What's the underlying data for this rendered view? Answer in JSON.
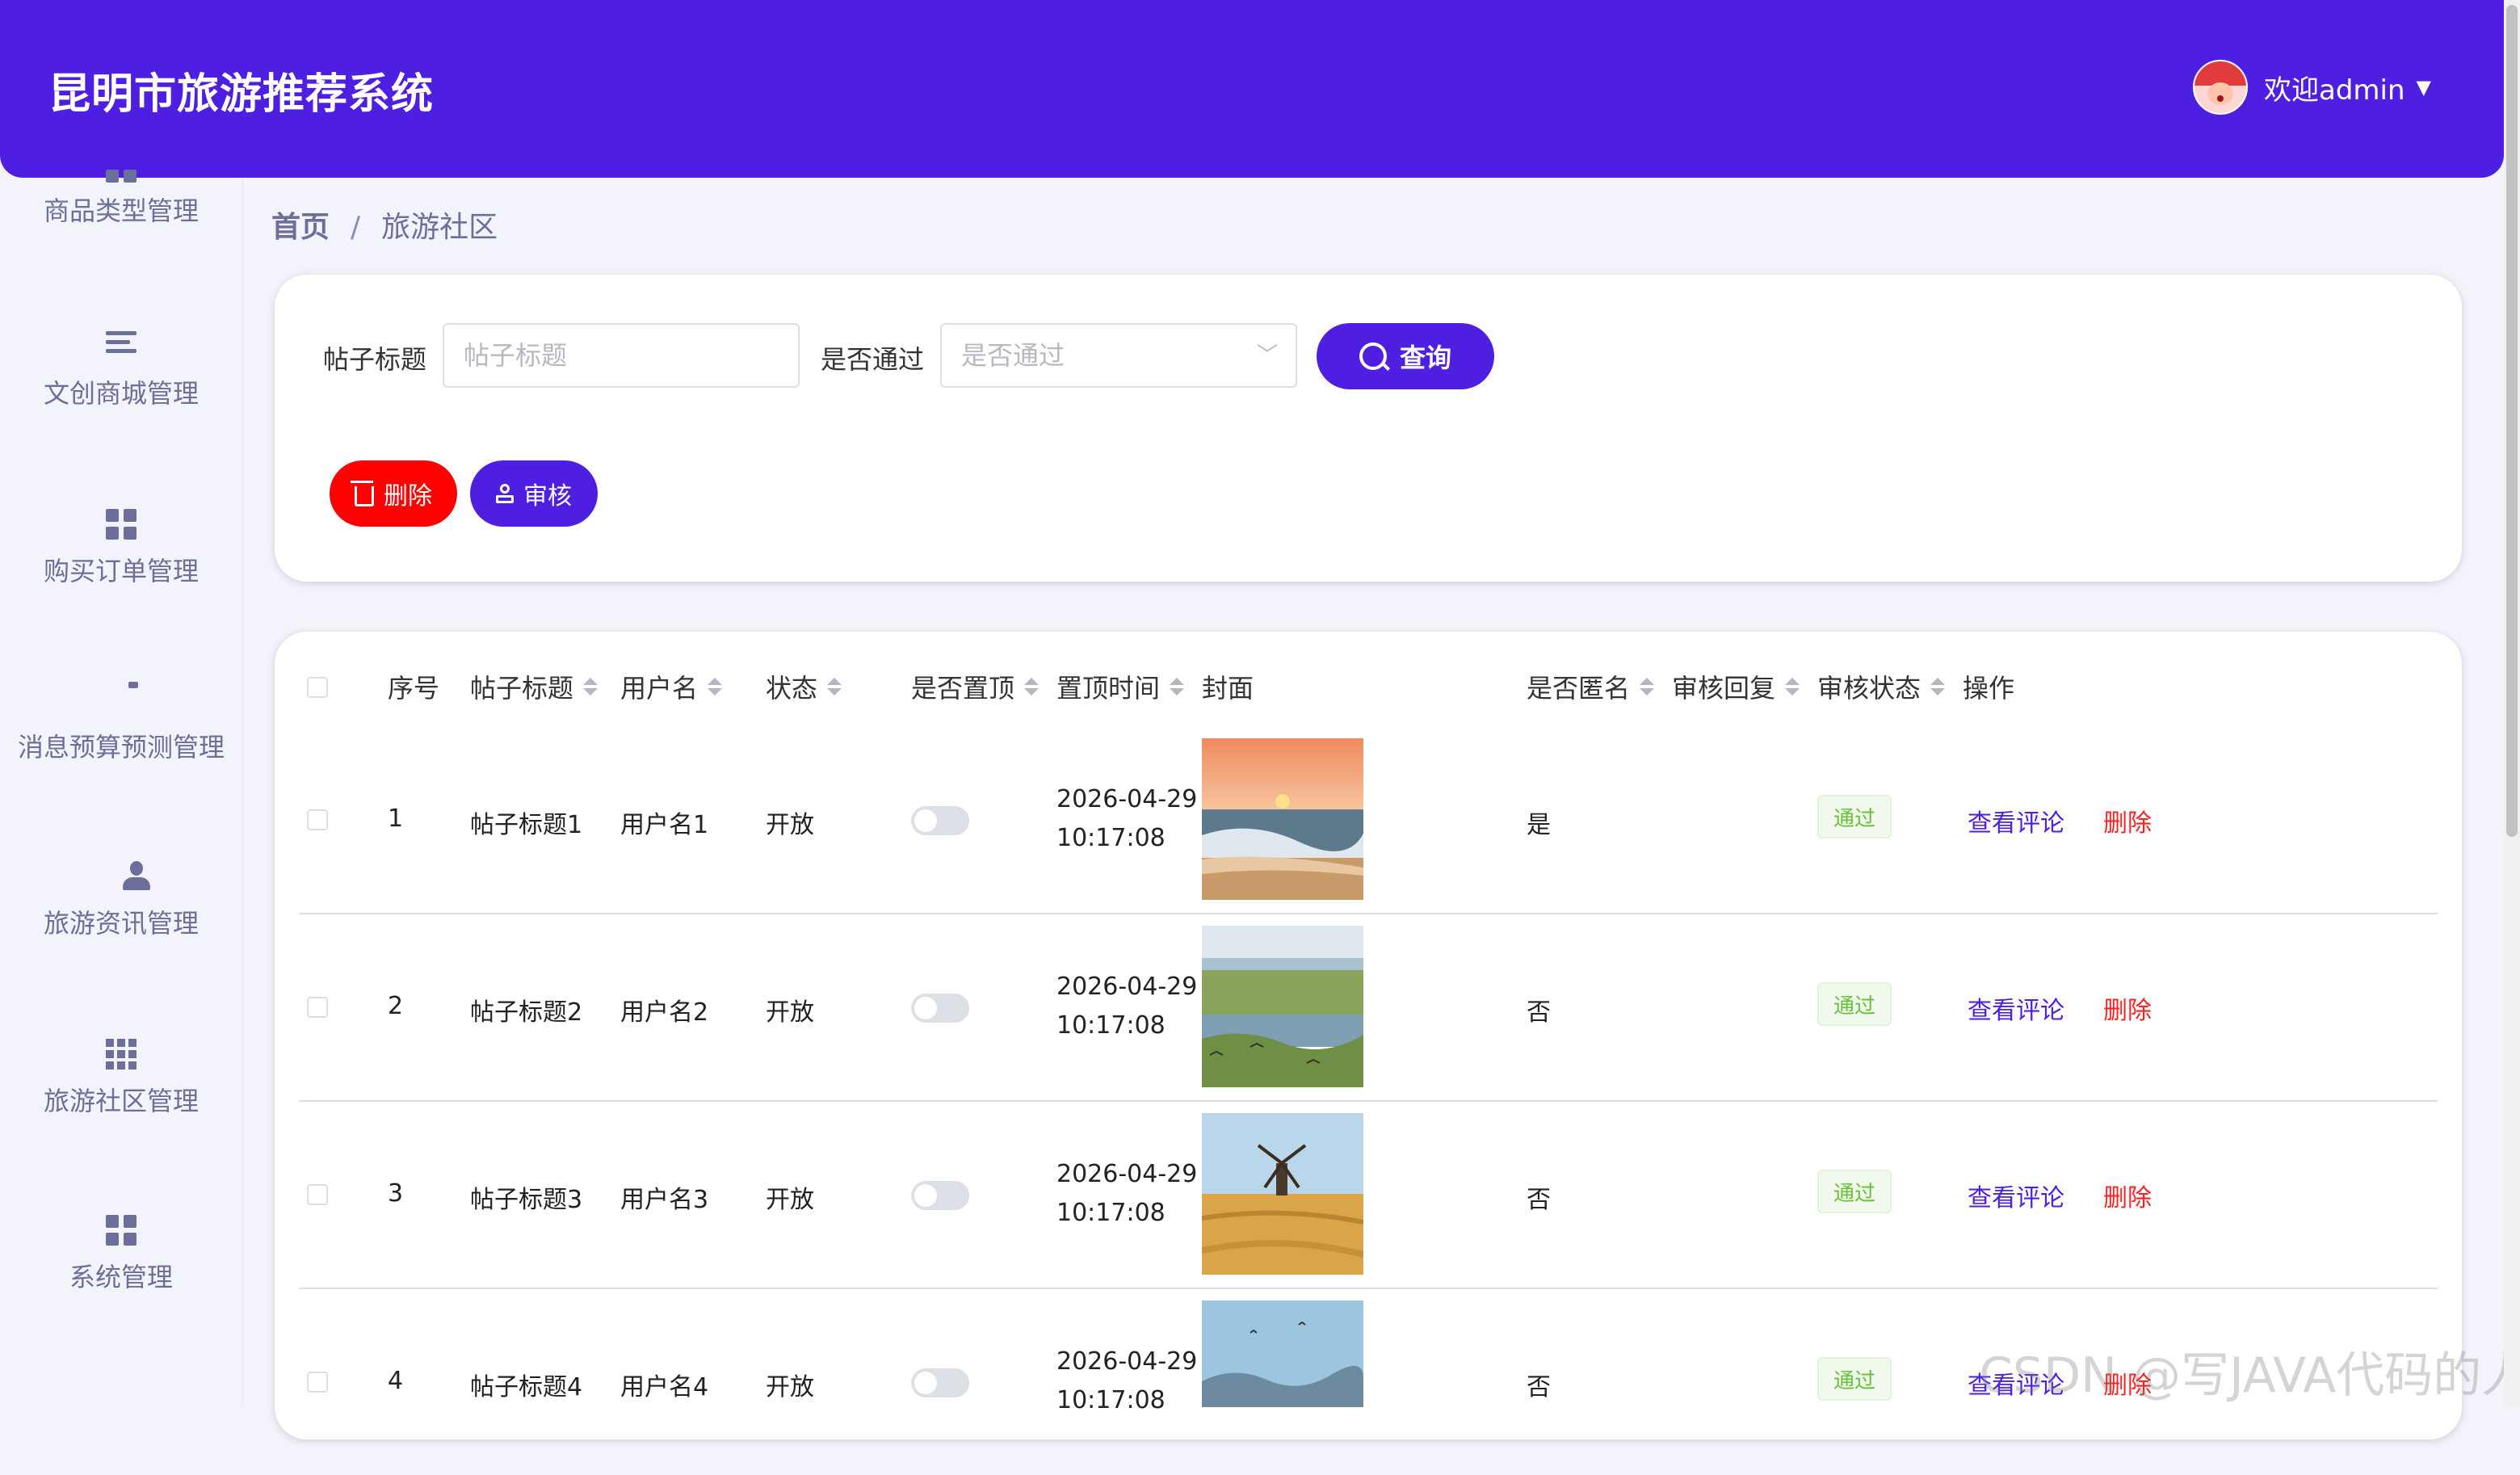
{
  "header": {
    "title": "昆明市旅游推荐系统",
    "welcome": "欢迎admin"
  },
  "sidebar": {
    "items": [
      {
        "label": "商品类型管理",
        "icon": "grid-icon"
      },
      {
        "label": "文创商城管理",
        "icon": "list-icon"
      },
      {
        "label": "购买订单管理",
        "icon": "grid-icon"
      },
      {
        "label": "消息预算预测管理",
        "icon": "clipboard-icon"
      },
      {
        "label": "旅游资讯管理",
        "icon": "user-icon"
      },
      {
        "label": "旅游社区管理",
        "icon": "apps-icon"
      },
      {
        "label": "系统管理",
        "icon": "grid-icon"
      }
    ]
  },
  "breadcrumb": {
    "home": "首页",
    "sep": "/",
    "current": "旅游社区"
  },
  "search": {
    "title_label": "帖子标题",
    "title_placeholder": "帖子标题",
    "pass_label": "是否通过",
    "pass_placeholder": "是否通过",
    "query_label": "查询",
    "delete_label": "删除",
    "audit_label": "审核"
  },
  "table": {
    "columns": [
      "序号",
      "帖子标题",
      "用户名",
      "状态",
      "是否置顶",
      "置顶时间",
      "封面",
      "是否匿名",
      "审核回复",
      "审核状态",
      "操作"
    ],
    "rows": [
      {
        "index": "1",
        "title": "帖子标题1",
        "username": "用户名1",
        "status": "开放",
        "date": "2026-04-29",
        "time": "10:17:08",
        "anonymous": "是",
        "audit": "通过",
        "view": "查看评论",
        "delete": "删除"
      },
      {
        "index": "2",
        "title": "帖子标题2",
        "username": "用户名2",
        "status": "开放",
        "date": "2026-04-29",
        "time": "10:17:08",
        "anonymous": "否",
        "audit": "通过",
        "view": "查看评论",
        "delete": "删除"
      },
      {
        "index": "3",
        "title": "帖子标题3",
        "username": "用户名3",
        "status": "开放",
        "date": "2026-04-29",
        "time": "10:17:08",
        "anonymous": "否",
        "audit": "通过",
        "view": "查看评论",
        "delete": "删除"
      },
      {
        "index": "4",
        "title": "帖子标题4",
        "username": "用户名4",
        "status": "开放",
        "date": "2026-04-29",
        "time": "10:17:08",
        "anonymous": "否",
        "audit": "通过",
        "view": "查看评论",
        "delete": "删除"
      }
    ]
  },
  "watermark": "CSDN @写JAVA代码的人",
  "colors": {
    "primary": "#4f1fe1",
    "danger": "#ff0000",
    "success": "#67c23a"
  }
}
